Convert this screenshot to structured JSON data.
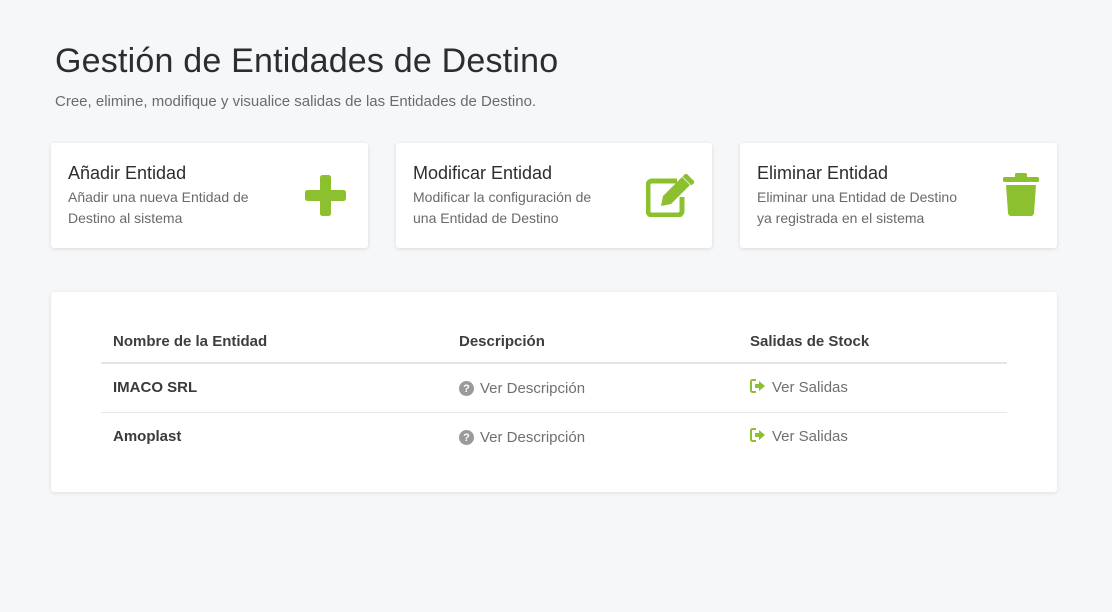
{
  "header": {
    "title": "Gestión de Entidades de Destino",
    "subtitle": "Cree, elimine, modifique y visualice salidas de las Entidades de Destino."
  },
  "cards": [
    {
      "title": "Añadir Entidad",
      "description": "Añadir una nueva Entidad de Destino al sistema",
      "icon": "plus-icon"
    },
    {
      "title": "Modificar Entidad",
      "description": "Modificar la configuración de una Entidad de Destino",
      "icon": "edit-icon"
    },
    {
      "title": "Eliminar Entidad",
      "description": "Eliminar una Entidad de Destino ya registrada en el sistema",
      "icon": "trash-icon"
    }
  ],
  "table": {
    "columns": [
      "Nombre de la Entidad",
      "Descripción",
      "Salidas de Stock"
    ],
    "rows": [
      {
        "name": "IMACO SRL",
        "description_link": "Ver Descripción",
        "outputs_link": "Ver Salidas"
      },
      {
        "name": "Amoplast",
        "description_link": "Ver Descripción",
        "outputs_link": "Ver Salidas"
      }
    ]
  },
  "colors": {
    "accent": "#8dc02f",
    "background": "#f6f7f9",
    "card": "#ffffff"
  }
}
